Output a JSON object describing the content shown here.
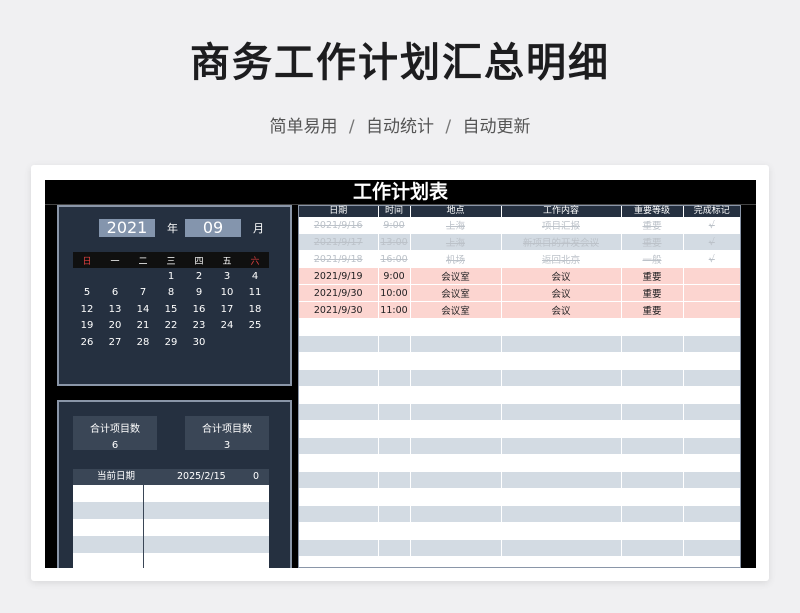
{
  "header": {
    "title": "商务工作计划汇总明细",
    "subtitle_parts": [
      "简单易用",
      "自动统计",
      "自动更新"
    ],
    "separator": "/"
  },
  "sheet": {
    "title": "工作计划表",
    "calendar": {
      "year": "2021",
      "year_label": "年",
      "month": "09",
      "month_label": "月",
      "weekdays": [
        "日",
        "一",
        "二",
        "三",
        "四",
        "五",
        "六"
      ],
      "weeks": [
        [
          "",
          "",
          "",
          "1",
          "2",
          "3",
          "4"
        ],
        [
          "5",
          "6",
          "7",
          "8",
          "9",
          "10",
          "11"
        ],
        [
          "12",
          "13",
          "14",
          "15",
          "16",
          "17",
          "18"
        ],
        [
          "19",
          "20",
          "21",
          "22",
          "23",
          "24",
          "25"
        ],
        [
          "26",
          "27",
          "28",
          "29",
          "30",
          "",
          ""
        ]
      ]
    },
    "summary": {
      "stat_a": {
        "label": "合计项目数",
        "value": "6"
      },
      "stat_b": {
        "label": "合计项目数",
        "value": "3"
      },
      "current_date_label": "当前日期",
      "current_date_value": "2025/2/15",
      "current_count": "0"
    },
    "plan": {
      "columns": [
        "日期",
        "时间",
        "地点",
        "工作内容",
        "重要等级",
        "完成标记"
      ],
      "rows": [
        {
          "status": "done",
          "cells": [
            "2021/9/16",
            "9:00",
            "上海",
            "项目汇报",
            "重要",
            "√"
          ]
        },
        {
          "status": "done",
          "cells": [
            "2021/9/17",
            "13:00",
            "上海",
            "新项目的开发会议",
            "重要",
            "√"
          ]
        },
        {
          "status": "done",
          "cells": [
            "2021/9/18",
            "16:00",
            "机场",
            "返回北京",
            "一般",
            "√"
          ]
        },
        {
          "status": "active",
          "cells": [
            "2021/9/19",
            "9:00",
            "会议室",
            "会议",
            "重要",
            ""
          ]
        },
        {
          "status": "active",
          "cells": [
            "2021/9/30",
            "10:00",
            "会议室",
            "会议",
            "重要",
            ""
          ]
        },
        {
          "status": "active",
          "cells": [
            "2021/9/30",
            "11:00",
            "会议室",
            "会议",
            "重要",
            ""
          ]
        }
      ]
    }
  },
  "colors": {
    "panel": "#253040",
    "highlight_row": "#fcd5d0",
    "stripe": "#d3dbe3",
    "weekend": "#e04040"
  }
}
